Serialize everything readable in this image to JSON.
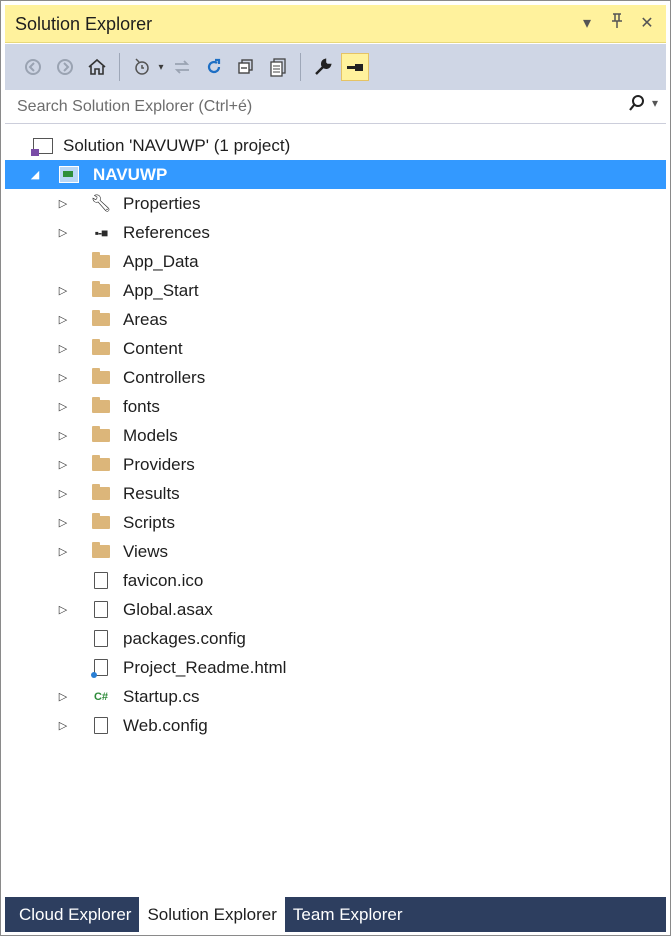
{
  "panel": {
    "title": "Solution Explorer",
    "pin_glyph": "▾",
    "pin2_glyph": "⊣",
    "close_glyph": "✕"
  },
  "toolbar": {
    "icons": [
      "back-icon",
      "forward-icon",
      "home-icon",
      "pending-changes-icon",
      "sync-icon",
      "refresh-icon",
      "collapse-all-icon",
      "show-all-files-icon",
      "properties-icon",
      "preview-icon"
    ]
  },
  "search": {
    "placeholder": "Search Solution Explorer (Ctrl+é)",
    "icon": "⌕",
    "dropdown": "▾"
  },
  "tree": {
    "solution": "Solution 'NAVUWP' (1 project)",
    "project": "NAVUWP",
    "items": [
      {
        "label": "Properties",
        "icon": "wrench-icon",
        "expandable": true
      },
      {
        "label": "References",
        "icon": "references-icon",
        "expandable": true
      },
      {
        "label": "App_Data",
        "icon": "folder-icon",
        "expandable": false
      },
      {
        "label": "App_Start",
        "icon": "folder-icon",
        "expandable": true
      },
      {
        "label": "Areas",
        "icon": "folder-icon",
        "expandable": true
      },
      {
        "label": "Content",
        "icon": "folder-icon",
        "expandable": true
      },
      {
        "label": "Controllers",
        "icon": "folder-icon",
        "expandable": true
      },
      {
        "label": "fonts",
        "icon": "folder-icon",
        "expandable": true
      },
      {
        "label": "Models",
        "icon": "folder-icon",
        "expandable": true
      },
      {
        "label": "Providers",
        "icon": "folder-icon",
        "expandable": true
      },
      {
        "label": "Results",
        "icon": "folder-icon",
        "expandable": true
      },
      {
        "label": "Scripts",
        "icon": "folder-icon",
        "expandable": true
      },
      {
        "label": "Views",
        "icon": "folder-icon",
        "expandable": true
      },
      {
        "label": "favicon.ico",
        "icon": "image-file-icon",
        "expandable": false
      },
      {
        "label": "Global.asax",
        "icon": "asax-file-icon",
        "expandable": true
      },
      {
        "label": "packages.config",
        "icon": "config-file-icon",
        "expandable": false
      },
      {
        "label": "Project_Readme.html",
        "icon": "html-file-icon",
        "expandable": false
      },
      {
        "label": "Startup.cs",
        "icon": "csharp-file-icon",
        "expandable": true
      },
      {
        "label": "Web.config",
        "icon": "config-file-icon",
        "expandable": true
      }
    ]
  },
  "bottom_tabs": {
    "cloud": "Cloud Explorer",
    "solution": "Solution Explorer",
    "team": "Team Explorer"
  }
}
